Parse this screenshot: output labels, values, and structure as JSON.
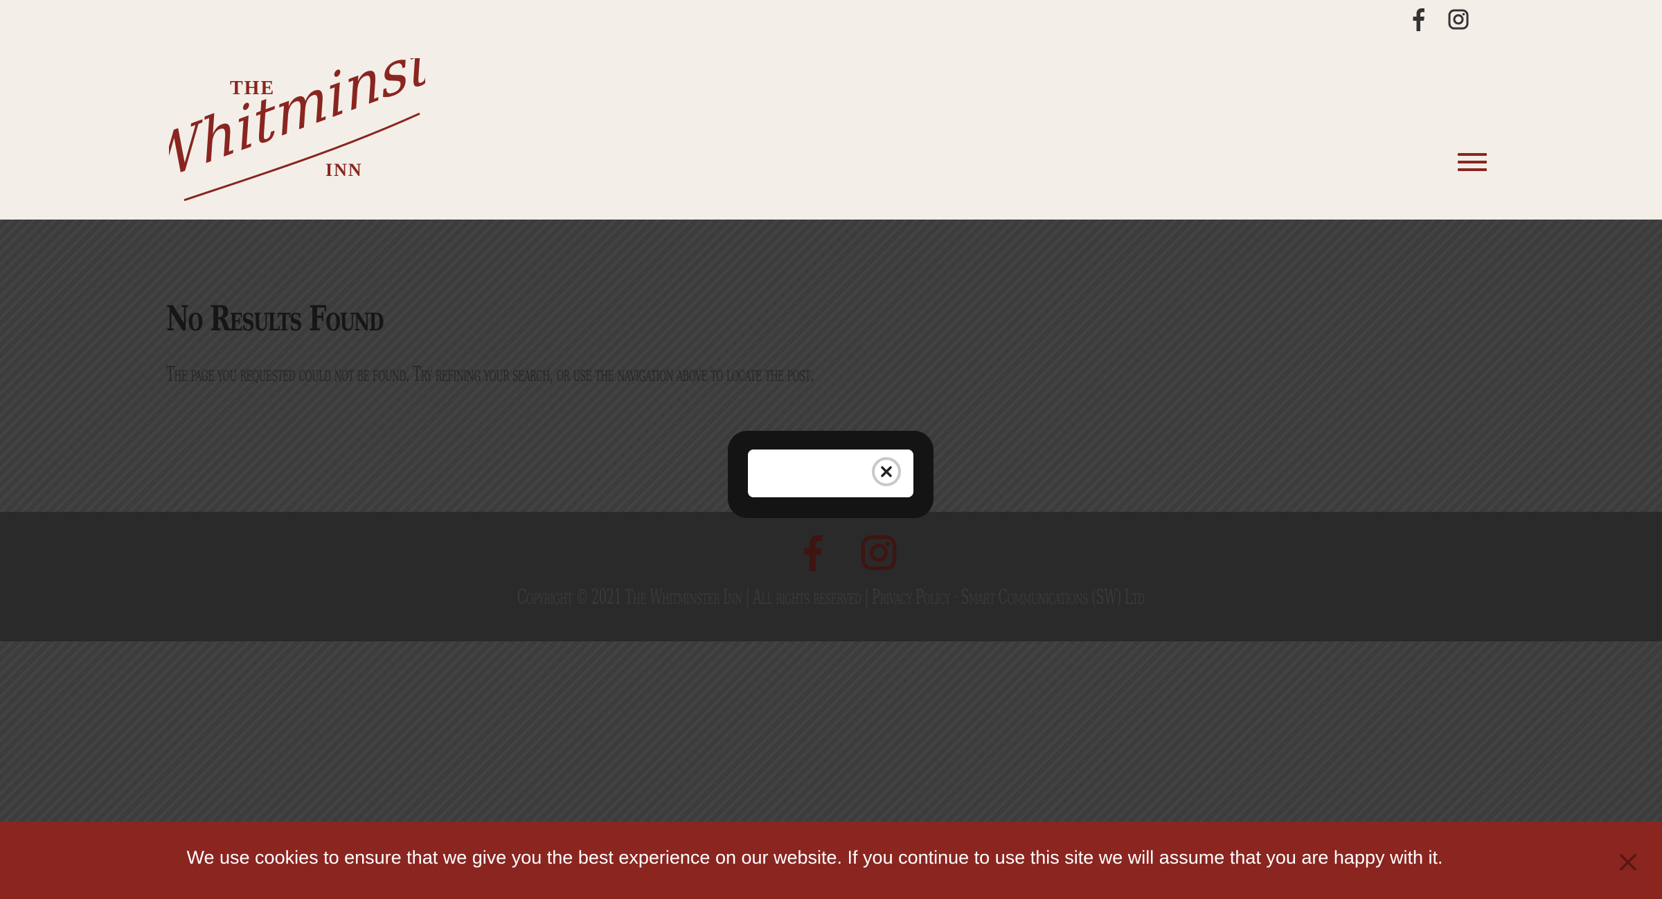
{
  "header": {
    "logo": {
      "line_the": "THE",
      "line_name": "Whitminster",
      "line_inn": "INN"
    },
    "social": [
      "facebook-icon",
      "instagram-icon"
    ],
    "menu_icon": "hamburger-menu-icon"
  },
  "main": {
    "title": "No Results Found",
    "message": "The page you requested could not be found. Try refining your search, or use the navigation above to locate the post."
  },
  "footer": {
    "social": [
      "facebook-icon",
      "instagram-icon"
    ],
    "copyright_text": "Copyright © 2021 The Whitminster Inn | All rights reserved | ",
    "privacy_link": "Privacy Policy",
    "separator": " · ",
    "credit_link": "Smart Communications (SW) Ltd"
  },
  "popup": {
    "close_icon": "close-icon",
    "close_label": "×"
  },
  "cookie_bar": {
    "text": "We use cookies to ensure that we give you the best experience on our website. If you continue to use this site we will assume that you are happy with it.",
    "close_label": "×"
  },
  "colors": {
    "brand_red": "#8a2520",
    "header_bg": "#f3efe8",
    "overlay_gray": "#3c3c3c",
    "footer_bg": "#2a2a2a"
  }
}
